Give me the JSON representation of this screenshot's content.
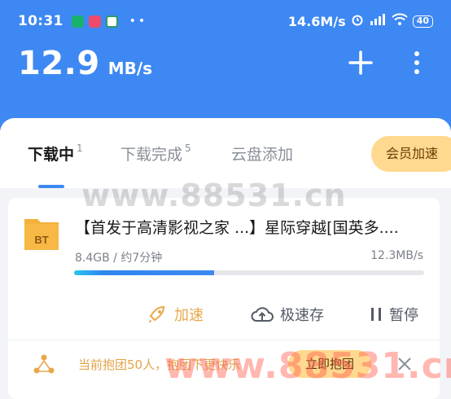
{
  "status_bar": {
    "time": "10:31",
    "net_speed": "14.6M/s",
    "battery": "40",
    "app_icons": [
      "ca-app-icon",
      "weibo-app-icon",
      "china-mobile-app-icon"
    ],
    "more_dots": "••"
  },
  "header": {
    "speed_value": "12.9",
    "speed_unit": "MB/s",
    "bg_color": "#3d88f2"
  },
  "tabs": [
    {
      "label": "下载中",
      "count": "1",
      "active": true
    },
    {
      "label": "下载完成",
      "count": "5",
      "active": false
    },
    {
      "label": "云盘添加",
      "count": "",
      "active": false
    }
  ],
  "vip_button": "会员加速",
  "task": {
    "icon_label": "BT",
    "title": "【首发于高清影视之家 ...】星际穿越[国英多....",
    "size_eta": "8.4GB / 约7分钟",
    "rate": "12.3MB/s",
    "progress": 0.4
  },
  "actions": {
    "boost": "加速",
    "save": "极速存",
    "pause": "暂停"
  },
  "group_banner": {
    "text": "当前抱团50人，抱团下更快乐",
    "button": "立即抱团"
  },
  "watermarks": {
    "center": "www.88531.cn",
    "bottom": "www.88531.cn"
  },
  "colors": {
    "accent": "#3d88f2",
    "gold": "#e8a84a",
    "vip_bg": "#ffd98f"
  }
}
